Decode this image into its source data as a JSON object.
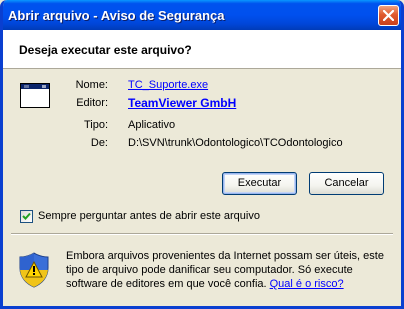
{
  "window": {
    "title": "Abrir arquivo - Aviso de Segurança"
  },
  "dialog": {
    "question": "Deseja executar este arquivo?",
    "fields": {
      "name_label": "Nome:",
      "name_value": "TC_Suporte.exe",
      "publisher_label": "Editor:",
      "publisher_value": "TeamViewer GmbH",
      "type_label": "Tipo:",
      "type_value": "Aplicativo",
      "from_label": "De:",
      "from_value": "D:\\SVN\\trunk\\Odontologico\\TCOdontologico"
    },
    "buttons": {
      "run": "Executar",
      "cancel": "Cancelar"
    },
    "checkbox": {
      "label": "Sempre perguntar antes de abrir este arquivo",
      "checked": true
    },
    "warning": {
      "text": "Embora arquivos provenientes da Internet possam ser úteis, este tipo de arquivo pode danificar seu computador. Só execute software de editores em que você confia.",
      "link": "Qual é o risco?"
    }
  },
  "icons": [
    "close-icon",
    "application-window-icon",
    "checkmark-icon",
    "security-shield-icon"
  ],
  "colors": {
    "titlebar": "#0053ee",
    "dialog_bg": "#ece9d8",
    "link": "#0000ff",
    "close_button": "#e05a2e"
  }
}
